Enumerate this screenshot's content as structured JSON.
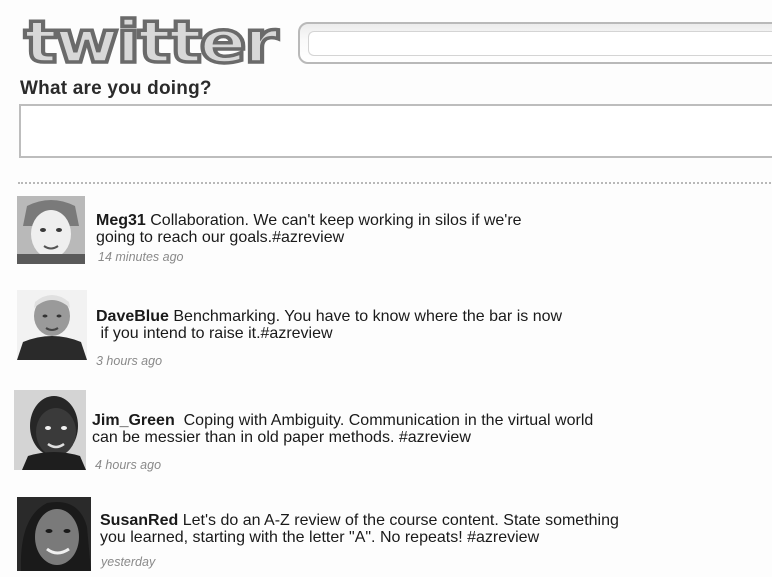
{
  "header": {
    "logo_text": "twitter",
    "search_placeholder": "",
    "prompt": "What are you doing?",
    "status_placeholder": ""
  },
  "tweets": [
    {
      "user": "Meg31",
      "line1": "Collaboration. We can't keep working in silos if we're",
      "line2": "going to reach our goals.#azreview",
      "time": "14 minutes ago"
    },
    {
      "user": "DaveBlue",
      "line1": "Benchmarking. You have to know where the bar is now",
      "line2": " if you intend to raise it.#azreview",
      "time": "3 hours ago"
    },
    {
      "user": "Jim_Green",
      "line1": " Coping with Ambiguity. Communication in the virtual world",
      "line2": "can be messier than in old paper methods. #azreview",
      "time": "4 hours ago"
    },
    {
      "user": "SusanRed",
      "line1": "Let's do an A-Z review of the course content. State something",
      "line2": "you learned, starting with the letter \"A\". No repeats! #azreview",
      "time": "yesterday"
    }
  ],
  "colors": {
    "text": "#1a1a1a",
    "timestamp": "#8a8a8a",
    "border": "#bdbdbd"
  }
}
